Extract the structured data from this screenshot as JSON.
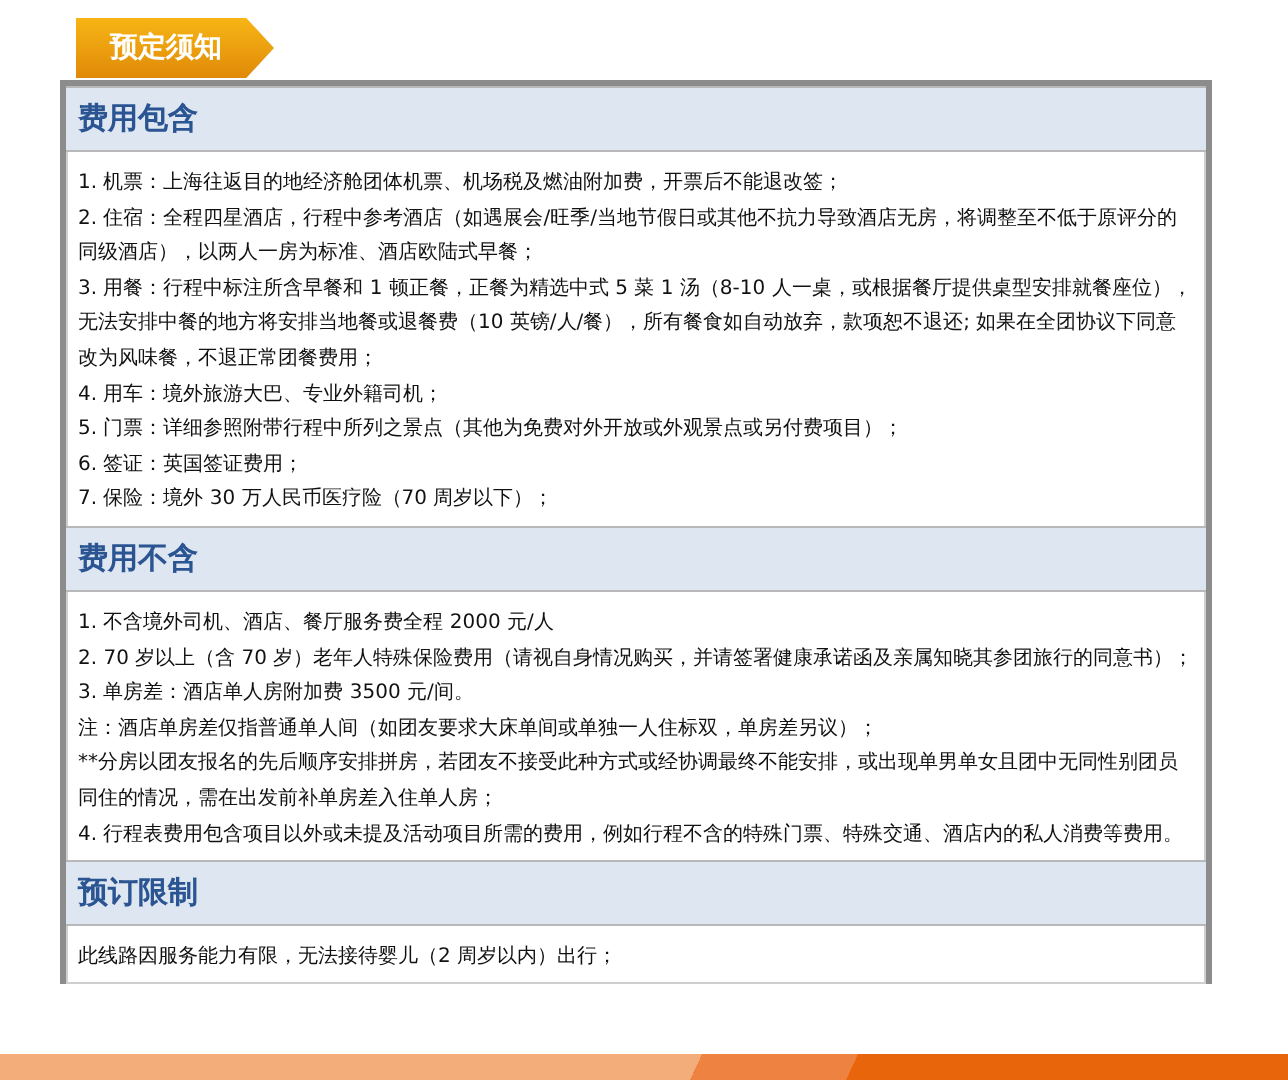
{
  "tag": {
    "label": "预定须知"
  },
  "sections": [
    {
      "heading": "费用包含",
      "items": [
        "1. 机票：上海往返目的地经济舱团体机票、机场税及燃油附加费，开票后不能退改签；",
        "2. 住宿：全程四星酒店，行程中参考酒店（如遇展会/旺季/当地节假日或其他不抗力导致酒店无房，将调整至不低于原评分的同级酒店），以两人一房为标准、酒店欧陆式早餐；",
        "3. 用餐：行程中标注所含早餐和 1 顿正餐，正餐为精选中式 5 菜 1 汤（8-10 人一桌，或根据餐厅提供桌型安排就餐座位），无法安排中餐的地方将安排当地餐或退餐费（10 英镑/人/餐），所有餐食如自动放弃，款项恕不退还; 如果在全团协议下同意改为风味餐，不退正常团餐费用；",
        "4. 用车：境外旅游大巴、专业外籍司机；",
        "5. 门票：详细参照附带行程中所列之景点（其他为免费对外开放或外观景点或另付费项目）；",
        "6. 签证：英国签证费用；",
        "7. 保险：境外 30 万人民币医疗险（70 周岁以下）；"
      ]
    },
    {
      "heading": "费用不含",
      "items": [
        "1. 不含境外司机、酒店、餐厅服务费全程 2000 元/人",
        "2. 70 岁以上（含 70 岁）老年人特殊保险费用（请视自身情况购买，并请签署健康承诺函及亲属知晓其参团旅行的同意书）；",
        "3. 单房差：酒店单人房附加费 3500 元/间。",
        "注：酒店单房差仅指普通单人间（如团友要求大床单间或单独一人住标双，单房差另议）；",
        "**分房以团友报名的先后顺序安排拼房，若团友不接受此种方式或经协调最终不能安排，或出现单男单女且团中无同性别团员同住的情况，需在出发前补单房差入住单人房；",
        "4. 行程表费用包含项目以外或未提及活动项目所需的费用，例如行程不含的特殊门票、特殊交通、酒店内的私人消费等费用。"
      ]
    },
    {
      "heading": "预订限制",
      "items": [
        "此线路因服务能力有限，无法接待婴儿（2 周岁以内）出行；"
      ]
    }
  ]
}
